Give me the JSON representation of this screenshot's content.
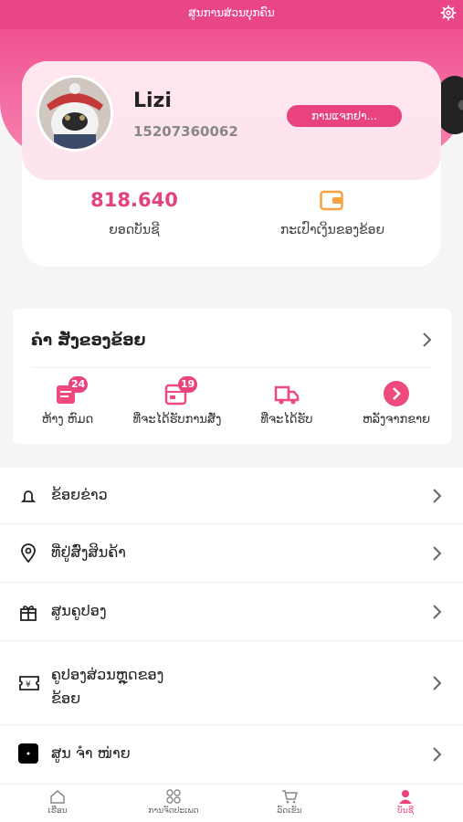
{
  "topbar": {
    "title": "ສູນການສ່ວນບຸກຄົນ",
    "settings_icon": "gear-icon"
  },
  "profile": {
    "username": "Lizi",
    "phone": "15207360062",
    "action_button": "ການແຈກຢາ...",
    "balance_value": "818.640",
    "balance_label": "ຍອດບັນຊີ",
    "wallet_label": "ກະເປົາເງິນຂອງຂ້ອຍ",
    "wallet_icon": "wallet-icon"
  },
  "orders": {
    "title": "ຄໍາ ສັ່ງຂອງຂ້ອຍ",
    "items": [
      {
        "label": "ຫ້າງ ຫົມດ",
        "badge": "24",
        "icon": "order-list-icon"
      },
      {
        "label": "ທີ່ຈະໄດ້ຮັບການສັ່ງ",
        "badge": "19",
        "icon": "pending-order-icon"
      },
      {
        "label": "ທີ່ຈະໄດ້ຮັບ",
        "badge": "",
        "icon": "truck-icon"
      },
      {
        "label": "ຫລັງຈາກຂາຍ",
        "badge": "",
        "icon": "arrow-circle-icon"
      }
    ]
  },
  "menu": [
    {
      "label": "ຂ້ອຍຂ່າວ",
      "icon": "bell-icon"
    },
    {
      "label": "ທີ່ຢູ່ສົ່ງສິນຄ້າ",
      "icon": "location-pin-icon"
    },
    {
      "label": "ສູນຄູປອງ",
      "icon": "gift-icon"
    },
    {
      "label": "ຄູປອງສ່ວນຫຼຸດຂອງ\nຂ້ອຍ",
      "icon": "coupon-icon"
    },
    {
      "label": "ສູນ ຈໍາ ໜ່າຍ",
      "icon": "app-icon"
    }
  ],
  "tabbar": [
    {
      "label": "ເຮືອນ",
      "icon": "home-icon",
      "active": false
    },
    {
      "label": "ການຈັດປະເພດ",
      "icon": "grid-icon",
      "active": false
    },
    {
      "label": "ລົດເຂັນ",
      "icon": "cart-icon",
      "active": false
    },
    {
      "label": "ບັນຊີ",
      "icon": "user-icon",
      "active": true
    }
  ],
  "colors": {
    "accent": "#e8437f",
    "header": "#f0468a",
    "orange": "#f5a341"
  }
}
